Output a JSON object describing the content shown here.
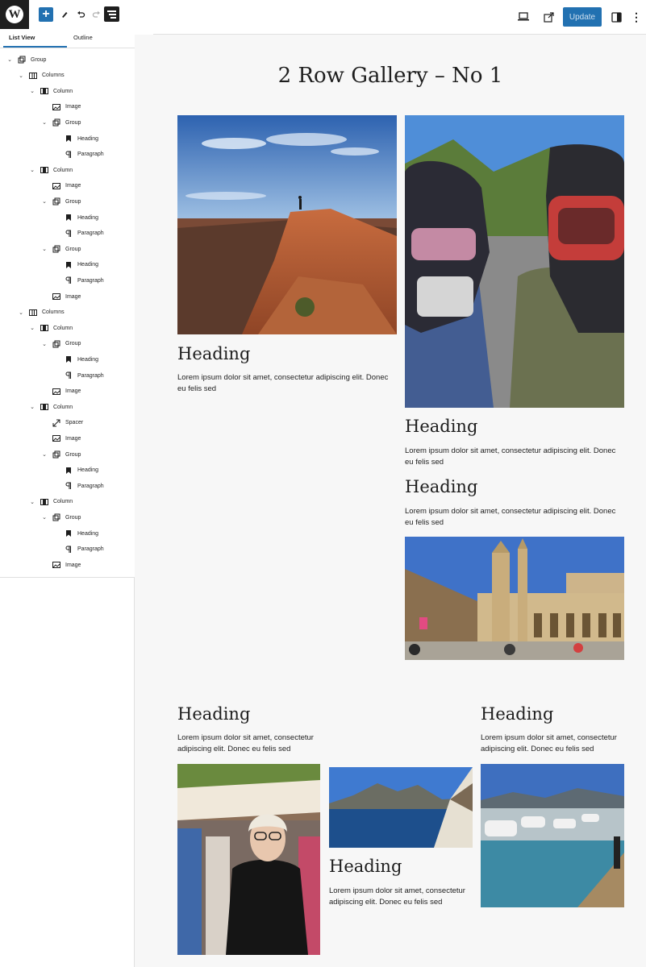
{
  "toolbar": {
    "update_label": "Update",
    "icons": [
      "wordpress-logo",
      "add-block-icon",
      "tools-pen-icon",
      "undo-icon",
      "redo-icon",
      "list-view-icon",
      "preview-desktop-icon",
      "view-post-icon",
      "settings-panel-icon",
      "more-options-icon"
    ]
  },
  "sidebar": {
    "tab_list": "List View",
    "tab_outline": "Outline",
    "close": "×",
    "tree": [
      {
        "label": "Group",
        "icon": "group",
        "depth": 0,
        "expanded": true
      },
      {
        "label": "Columns",
        "icon": "columns",
        "depth": 1,
        "expanded": true
      },
      {
        "label": "Column",
        "icon": "column",
        "depth": 2,
        "expanded": true
      },
      {
        "label": "Image",
        "icon": "image",
        "depth": 3,
        "expanded": null
      },
      {
        "label": "Group",
        "icon": "group",
        "depth": 3,
        "expanded": true
      },
      {
        "label": "Heading",
        "icon": "heading",
        "depth": 4,
        "expanded": null
      },
      {
        "label": "Paragraph",
        "icon": "paragraph",
        "depth": 4,
        "expanded": null
      },
      {
        "label": "Column",
        "icon": "column",
        "depth": 2,
        "expanded": true
      },
      {
        "label": "Image",
        "icon": "image",
        "depth": 3,
        "expanded": null
      },
      {
        "label": "Group",
        "icon": "group",
        "depth": 3,
        "expanded": true
      },
      {
        "label": "Heading",
        "icon": "heading",
        "depth": 4,
        "expanded": null
      },
      {
        "label": "Paragraph",
        "icon": "paragraph",
        "depth": 4,
        "expanded": null
      },
      {
        "label": "Group",
        "icon": "group",
        "depth": 3,
        "expanded": true
      },
      {
        "label": "Heading",
        "icon": "heading",
        "depth": 4,
        "expanded": null
      },
      {
        "label": "Paragraph",
        "icon": "paragraph",
        "depth": 4,
        "expanded": null
      },
      {
        "label": "Image",
        "icon": "image",
        "depth": 3,
        "expanded": null
      },
      {
        "label": "Columns",
        "icon": "columns",
        "depth": 1,
        "expanded": true
      },
      {
        "label": "Column",
        "icon": "column",
        "depth": 2,
        "expanded": true
      },
      {
        "label": "Group",
        "icon": "group",
        "depth": 3,
        "expanded": true
      },
      {
        "label": "Heading",
        "icon": "heading",
        "depth": 4,
        "expanded": null
      },
      {
        "label": "Paragraph",
        "icon": "paragraph",
        "depth": 4,
        "expanded": null
      },
      {
        "label": "Image",
        "icon": "image",
        "depth": 3,
        "expanded": null
      },
      {
        "label": "Column",
        "icon": "column",
        "depth": 2,
        "expanded": true
      },
      {
        "label": "Spacer",
        "icon": "spacer",
        "depth": 3,
        "expanded": null
      },
      {
        "label": "Image",
        "icon": "image",
        "depth": 3,
        "expanded": null
      },
      {
        "label": "Group",
        "icon": "group",
        "depth": 3,
        "expanded": true
      },
      {
        "label": "Heading",
        "icon": "heading",
        "depth": 4,
        "expanded": null
      },
      {
        "label": "Paragraph",
        "icon": "paragraph",
        "depth": 4,
        "expanded": null
      },
      {
        "label": "Column",
        "icon": "column",
        "depth": 2,
        "expanded": true
      },
      {
        "label": "Group",
        "icon": "group",
        "depth": 3,
        "expanded": true
      },
      {
        "label": "Heading",
        "icon": "heading",
        "depth": 4,
        "expanded": null
      },
      {
        "label": "Paragraph",
        "icon": "paragraph",
        "depth": 4,
        "expanded": null
      },
      {
        "label": "Image",
        "icon": "image",
        "depth": 3,
        "expanded": null
      }
    ]
  },
  "content": {
    "page_title": "2 Row Gallery – No 1",
    "heading": "Heading",
    "paragraph": "Lorem ipsum dolor sit amet, consectetur adipiscing elit. Donec eu felis sed",
    "images": [
      "desert-canyon-photo",
      "helmets-selfie-photo",
      "cathedral-photo",
      "market-portrait-photo",
      "coastal-boat-photo",
      "harbor-boats-photo"
    ]
  },
  "colors": {
    "accent": "#2271b1",
    "canvas_bg": "#f7f7f7"
  }
}
